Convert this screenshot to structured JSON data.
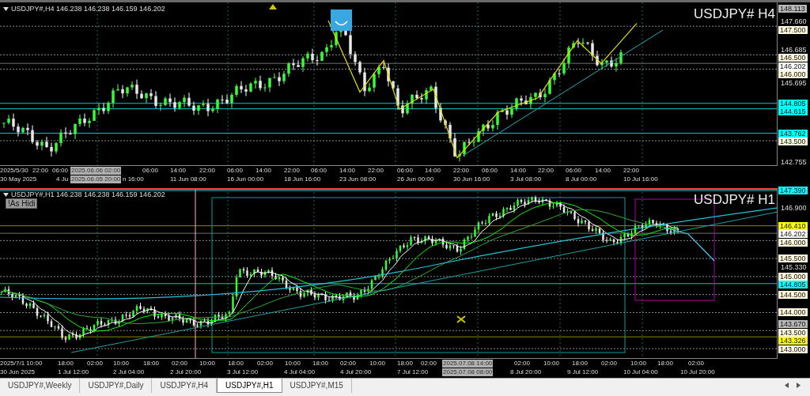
{
  "panes": [
    {
      "header": "USDJPY#,H4 146.238 146.238 146.159 146.202",
      "symbol_label": "USDJPY# H4",
      "price_labels": [
        {
          "text": "148.113",
          "kind": "gray"
        },
        {
          "text": "147.660",
          "kind": "plain"
        },
        {
          "text": "147.500",
          "kind": "cream"
        },
        {
          "text": "146.685",
          "kind": "plain"
        },
        {
          "text": "146.500",
          "kind": "cream"
        },
        {
          "text": "146.202",
          "kind": "white"
        },
        {
          "text": "146.000",
          "kind": "cream"
        },
        {
          "text": "145.695",
          "kind": "plain"
        },
        {
          "text": "144.805",
          "kind": "cyan"
        },
        {
          "text": "144.615",
          "kind": "cyan"
        },
        {
          "text": "143.762",
          "kind": "cyan"
        },
        {
          "text": "143.500",
          "kind": "cream"
        },
        {
          "text": "142.755",
          "kind": "plain"
        }
      ],
      "time_axis": {
        "row_1": [
          {
            "text": "2025/5/30",
            "kind": "plain"
          },
          {
            "text": "22:00",
            "kind": "plain"
          },
          {
            "text": "06:00",
            "kind": "plain"
          },
          {
            "text": "2025.06.06 02:00",
            "kind": "highlight"
          },
          {
            "text": "06:00",
            "kind": "plain"
          },
          {
            "text": "14:00",
            "kind": "plain"
          },
          {
            "text": "22:00",
            "kind": "plain"
          },
          {
            "text": "06:00",
            "kind": "plain"
          },
          {
            "text": "14:00",
            "kind": "plain"
          },
          {
            "text": "22:00",
            "kind": "plain"
          },
          {
            "text": "06:00",
            "kind": "plain"
          },
          {
            "text": "14:00",
            "kind": "plain"
          },
          {
            "text": "22:00",
            "kind": "plain"
          },
          {
            "text": "06:00",
            "kind": "plain"
          },
          {
            "text": "14:00",
            "kind": "plain"
          },
          {
            "text": "22:00",
            "kind": "plain"
          },
          {
            "text": "06:00",
            "kind": "plain"
          },
          {
            "text": "14:00",
            "kind": "plain"
          },
          {
            "text": "22:00",
            "kind": "plain"
          },
          {
            "text": "06:00",
            "kind": "plain"
          },
          {
            "text": "14:00",
            "kind": "plain"
          },
          {
            "text": "22:00",
            "kind": "plain"
          }
        ],
        "row_2": [
          {
            "text": "30 May 2025",
            "kind": "plain"
          },
          {
            "text": "4 Ju",
            "kind": "plain"
          },
          {
            "text": "2025.06.05 20:00",
            "kind": "highlight"
          },
          {
            "text": "n 16:00",
            "kind": "plain"
          },
          {
            "text": "11 Jun 08:00",
            "kind": "plain"
          },
          {
            "text": "16 Jun 00:00",
            "kind": "plain"
          },
          {
            "text": "18 Jun 16:00",
            "kind": "plain"
          },
          {
            "text": "23 Jun 08:00",
            "kind": "plain"
          },
          {
            "text": "26 Jun 00:00",
            "kind": "plain"
          },
          {
            "text": "30 Jun 16:00",
            "kind": "plain"
          },
          {
            "text": "3 Jul 08:00",
            "kind": "plain"
          },
          {
            "text": "8 Jul 00:00",
            "kind": "plain"
          },
          {
            "text": "10 Jul 16:00",
            "kind": "plain"
          }
        ]
      }
    },
    {
      "header": "USDJPY#,H1 146.238 146.238 146.159 146.202",
      "symbol_label": "USDJPY# H1",
      "hide_button": "!As Hidi",
      "price_labels": [
        {
          "text": "147.390",
          "kind": "cyan"
        },
        {
          "text": "146.900",
          "kind": "plain"
        },
        {
          "text": "146.410",
          "kind": "yellow"
        },
        {
          "text": "146.202",
          "kind": "white"
        },
        {
          "text": "146.000",
          "kind": "cream"
        },
        {
          "text": "145.500",
          "kind": "cream"
        },
        {
          "text": "145.330",
          "kind": "plain"
        },
        {
          "text": "145.000",
          "kind": "cream"
        },
        {
          "text": "144.805",
          "kind": "cyan"
        },
        {
          "text": "144.500",
          "kind": "cream"
        },
        {
          "text": "144.000",
          "kind": "cream"
        },
        {
          "text": "143.670",
          "kind": "gray"
        },
        {
          "text": "143.500",
          "kind": "cream"
        },
        {
          "text": "143.326",
          "kind": "yellow"
        },
        {
          "text": "143.000",
          "kind": "cream"
        }
      ],
      "time_axis": {
        "row_1": [
          {
            "text": "2025/7/1 10:00",
            "kind": "plain"
          },
          {
            "text": "18:00",
            "kind": "plain"
          },
          {
            "text": "02:00",
            "kind": "plain"
          },
          {
            "text": "10:00",
            "kind": "plain"
          },
          {
            "text": "18:00",
            "kind": "plain"
          },
          {
            "text": "02:00",
            "kind": "plain"
          },
          {
            "text": "10:00",
            "kind": "plain"
          },
          {
            "text": "18:00",
            "kind": "plain"
          },
          {
            "text": "02:00",
            "kind": "plain"
          },
          {
            "text": "10:00",
            "kind": "plain"
          },
          {
            "text": "18:00",
            "kind": "plain"
          },
          {
            "text": "02:00",
            "kind": "plain"
          },
          {
            "text": "10:00",
            "kind": "plain"
          },
          {
            "text": "18:00",
            "kind": "plain"
          },
          {
            "text": "02:00",
            "kind": "plain"
          },
          {
            "text": "2025.07.08 14:00",
            "kind": "highlight"
          },
          {
            "text": "02:00",
            "kind": "plain"
          },
          {
            "text": "10:00",
            "kind": "plain"
          },
          {
            "text": "18:00",
            "kind": "plain"
          },
          {
            "text": "02:00",
            "kind": "plain"
          },
          {
            "text": "10:00",
            "kind": "plain"
          },
          {
            "text": "18:00",
            "kind": "plain"
          },
          {
            "text": "02:00",
            "kind": "plain"
          }
        ],
        "row_2": [
          {
            "text": "30 Jun 2025",
            "kind": "plain"
          },
          {
            "text": "1 Jul 12:00",
            "kind": "plain"
          },
          {
            "text": "2 Jul 04:00",
            "kind": "plain"
          },
          {
            "text": "2 Jul 20:00",
            "kind": "plain"
          },
          {
            "text": "3 Jul 12:00",
            "kind": "plain"
          },
          {
            "text": "4 Jul 04:00",
            "kind": "plain"
          },
          {
            "text": "4 Jul 20:00",
            "kind": "plain"
          },
          {
            "text": "7 Jul 12:00",
            "kind": "plain"
          },
          {
            "text": "2025.07.08 08:00",
            "kind": "highlight"
          },
          {
            "text": "8 Jul 20:00",
            "kind": "plain"
          },
          {
            "text": "9 Jul 12:00",
            "kind": "plain"
          },
          {
            "text": "10 Jul 04:00",
            "kind": "plain"
          },
          {
            "text": "10 Jul 20:00",
            "kind": "plain"
          }
        ]
      }
    }
  ],
  "tabs": [
    {
      "label": "USDJPY#,Weekly",
      "selected": false
    },
    {
      "label": "USDJPY#,Daily",
      "selected": false
    },
    {
      "label": "USDJPY#,H4",
      "selected": false
    },
    {
      "label": "USDJPY#,H1",
      "selected": true
    },
    {
      "label": "USDJPY#,M15",
      "selected": false
    }
  ]
}
